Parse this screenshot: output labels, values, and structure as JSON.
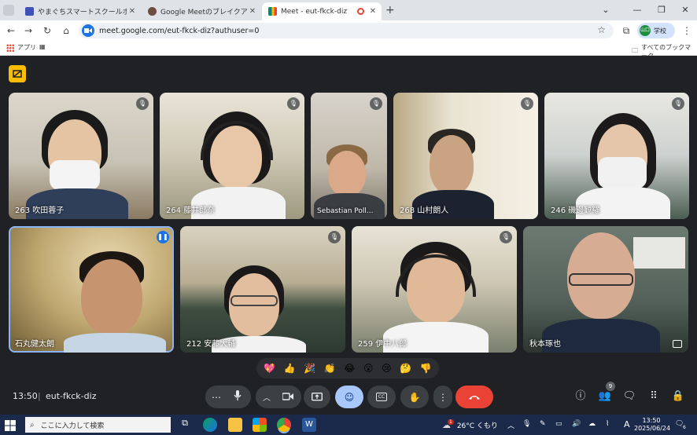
{
  "browser": {
    "tabs": [
      {
        "label": "やまぐちスマートスクールポータルサイト",
        "favicon_color": "#3f51b5",
        "active": false
      },
      {
        "label": "Google Meetのブレイクアウトル...",
        "favicon_color": "#6d4c41",
        "active": false
      },
      {
        "label": "Meet - eut-fkck-diz",
        "favicon_color": "#00897b",
        "active": true
      }
    ],
    "new_tab": "+",
    "window_controls": {
      "minimize": "⌄",
      "min": "—",
      "max": "❐",
      "close": "✕"
    },
    "url": "meet.google.com/eut-fkck-diz?authuser=0",
    "profile_label": "学校",
    "profile_initials": "山口",
    "bookmarks": {
      "apps": "アプリ",
      "all_bookmarks": "すべてのブックマーク"
    }
  },
  "meet": {
    "participants_row1": [
      {
        "name": "263 吹田蓉子",
        "muted": true
      },
      {
        "name": "264 藤井郎奈",
        "muted": true
      },
      {
        "name": "Sebastian Poll...",
        "muted": true
      },
      {
        "name": "268 山村朗人",
        "muted": true
      },
      {
        "name": "246 磯邊観羅",
        "muted": true
      }
    ],
    "participants_row2": [
      {
        "name": "石丸健太朗",
        "muted": false,
        "speaking": true
      },
      {
        "name": "212 安藤大輔",
        "muted": true
      },
      {
        "name": "259 伊中八郎",
        "muted": true
      },
      {
        "name": "秋本琢也",
        "muted": false
      }
    ],
    "reactions": [
      "💖",
      "👍",
      "🎉",
      "👏",
      "😂",
      "😮",
      "😢",
      "🤔",
      "👎"
    ],
    "time": "13:50",
    "meeting_code": "eut-fkck-diz",
    "participant_count": "9",
    "colors": {
      "end_call": "#ea4335",
      "active_btn": "#a8c7fa",
      "speaking_outline": "#8ab4f8",
      "accent_yellow": "#fbbc04"
    }
  },
  "taskbar": {
    "search_placeholder": "ここに入力して検索",
    "weather": "26°C くもり",
    "weather_badge": "1",
    "ime": "A",
    "clock_time": "13:50",
    "clock_date": "2025/06/24",
    "notification_count": "6"
  }
}
